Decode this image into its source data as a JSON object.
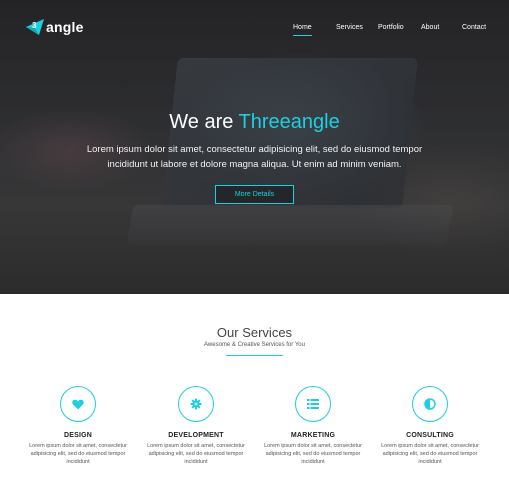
{
  "brand": {
    "logo_mark_text": "3",
    "logo_text": "angle",
    "accent_color": "#1ecfe0"
  },
  "nav": {
    "items": [
      {
        "label": "Home",
        "active": true
      },
      {
        "label": "Services",
        "active": false
      },
      {
        "label": "Portfolio",
        "active": false
      },
      {
        "label": "About",
        "active": false
      },
      {
        "label": "Contact",
        "active": false
      }
    ]
  },
  "hero": {
    "title_prefix": "We are ",
    "title_accent": "Threeangle",
    "description": "Lorem ipsum dolor sit amet, consectetur adipisicing elit, sed do eiusmod tempor incididunt ut labore et dolore magna aliqua. Ut enim ad minim veniam.",
    "button_label": "More Details"
  },
  "services": {
    "title": "Our Services",
    "subtitle": "Awesome & Creative Services for You",
    "items": [
      {
        "name": "DESIGN",
        "icon": "heart-icon",
        "text": "Lorem ipsum dolor sit amet, consectetur adipisicing elit, sed do eiusmod tempor incididunt"
      },
      {
        "name": "DEVELOPMENT",
        "icon": "gear-icon",
        "text": "Lorem ipsum dolor sit amet, consectetur adipisicing elit, sed do eiusmod tempor incididunt"
      },
      {
        "name": "MARKETING",
        "icon": "list-icon",
        "text": "Lorem ipsum dolor sit amet, consectetur adipisicing elit, sed do eiusmod tempor incididunt"
      },
      {
        "name": "CONSULTING",
        "icon": "contrast-icon",
        "text": "Lorem ipsum dolor sit amet, consectetur adipisicing elit, sed do eiusmod tempor incididunt"
      }
    ]
  }
}
